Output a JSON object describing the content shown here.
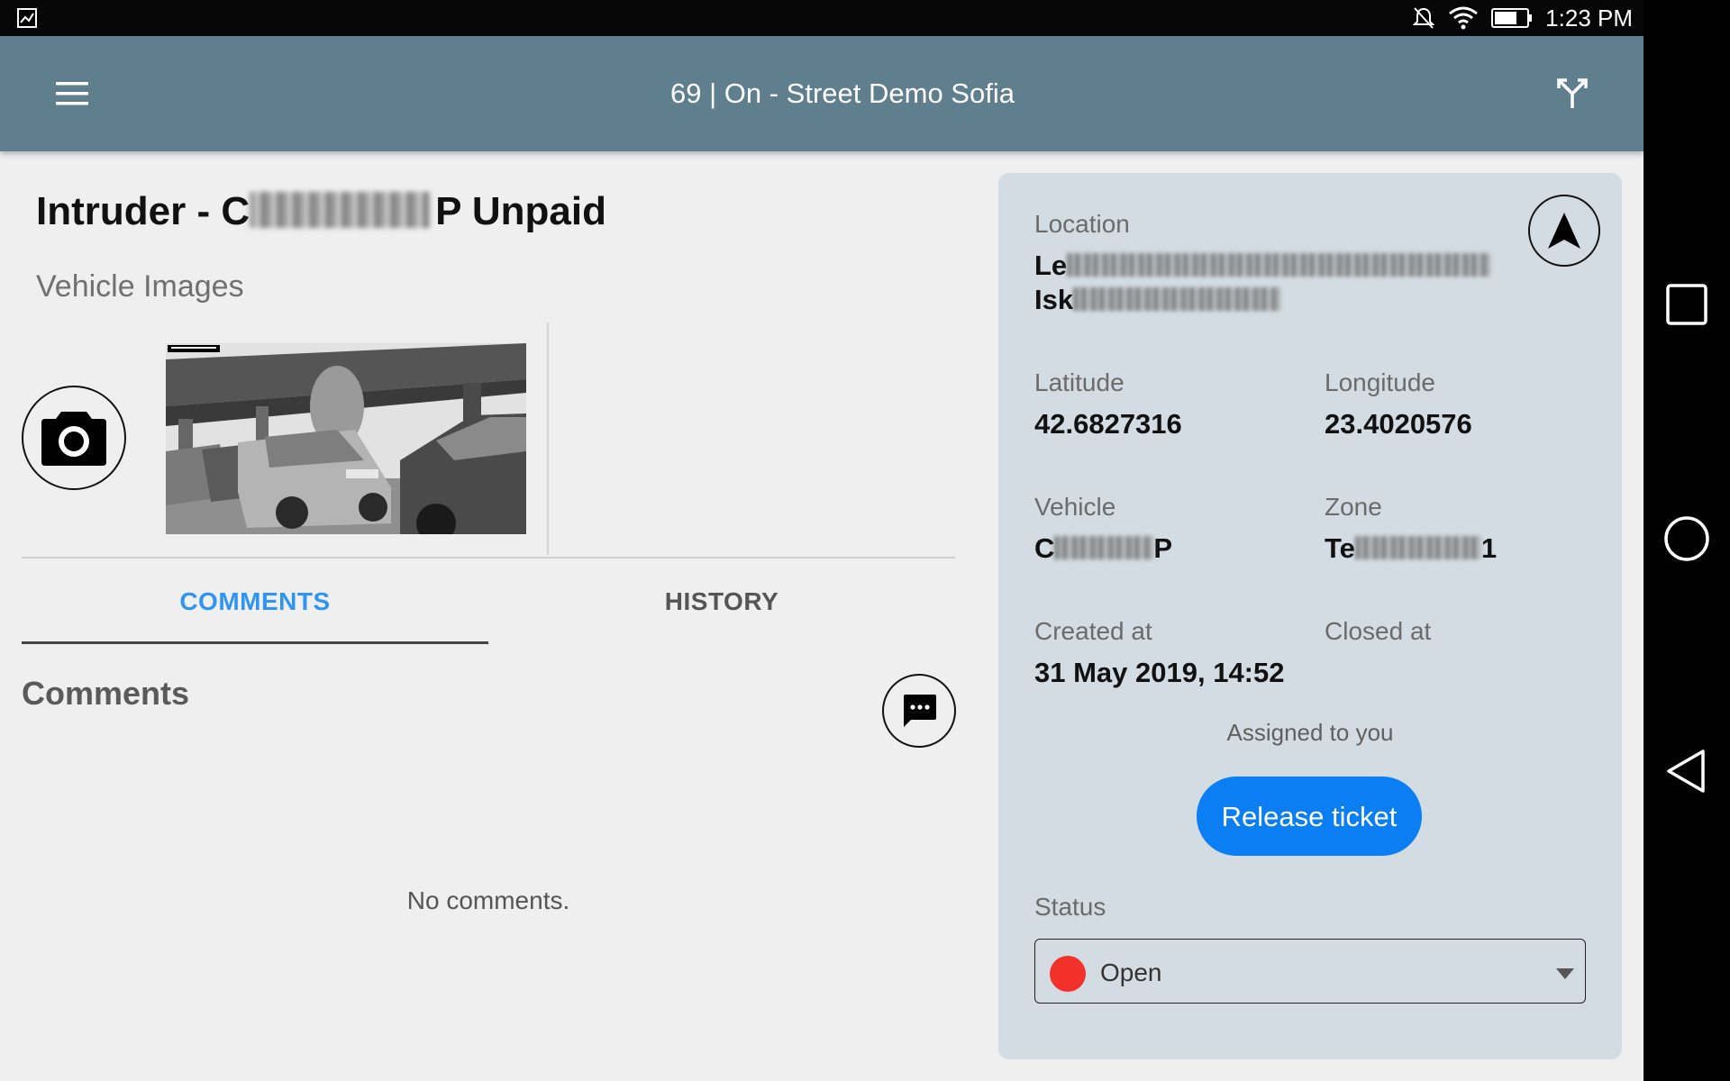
{
  "status_bar": {
    "time": "1:23 PM",
    "icons": [
      "image-icon",
      "mute-icon",
      "wifi-icon",
      "battery-icon"
    ]
  },
  "app_bar": {
    "title": "69 | On - Street Demo Sofia",
    "menu_icon": "menu-icon",
    "action_icon": "merge-icon",
    "background": "#5f7f8f"
  },
  "ticket": {
    "title_prefix": "Intruder - C",
    "title_suffix": "P Unpaid"
  },
  "images": {
    "section_label": "Vehicle Images"
  },
  "tabs": [
    {
      "label": "COMMENTS",
      "active": true
    },
    {
      "label": "HISTORY",
      "active": false
    }
  ],
  "comments": {
    "heading": "Comments",
    "empty_text": "No comments."
  },
  "details": {
    "location_label": "Location",
    "location_line1": "Le",
    "location_line2": "Isk",
    "latitude_label": "Latitude",
    "latitude_value": "42.6827316",
    "longitude_label": "Longitude",
    "longitude_value": "23.4020576",
    "vehicle_label": "Vehicle",
    "vehicle_value": "C",
    "vehicle_value_end": "P",
    "zone_label": "Zone",
    "zone_value": "Te",
    "zone_value_end": "1",
    "created_label": "Created at",
    "created_value": "31 May 2019, 14:52",
    "closed_label": "Closed at",
    "closed_value": "",
    "assigned_text": "Assigned to you",
    "release_button": "Release ticket",
    "status_label": "Status",
    "status_value": "Open",
    "status_color": "#f2322a",
    "accent": "#0a7ef2"
  }
}
